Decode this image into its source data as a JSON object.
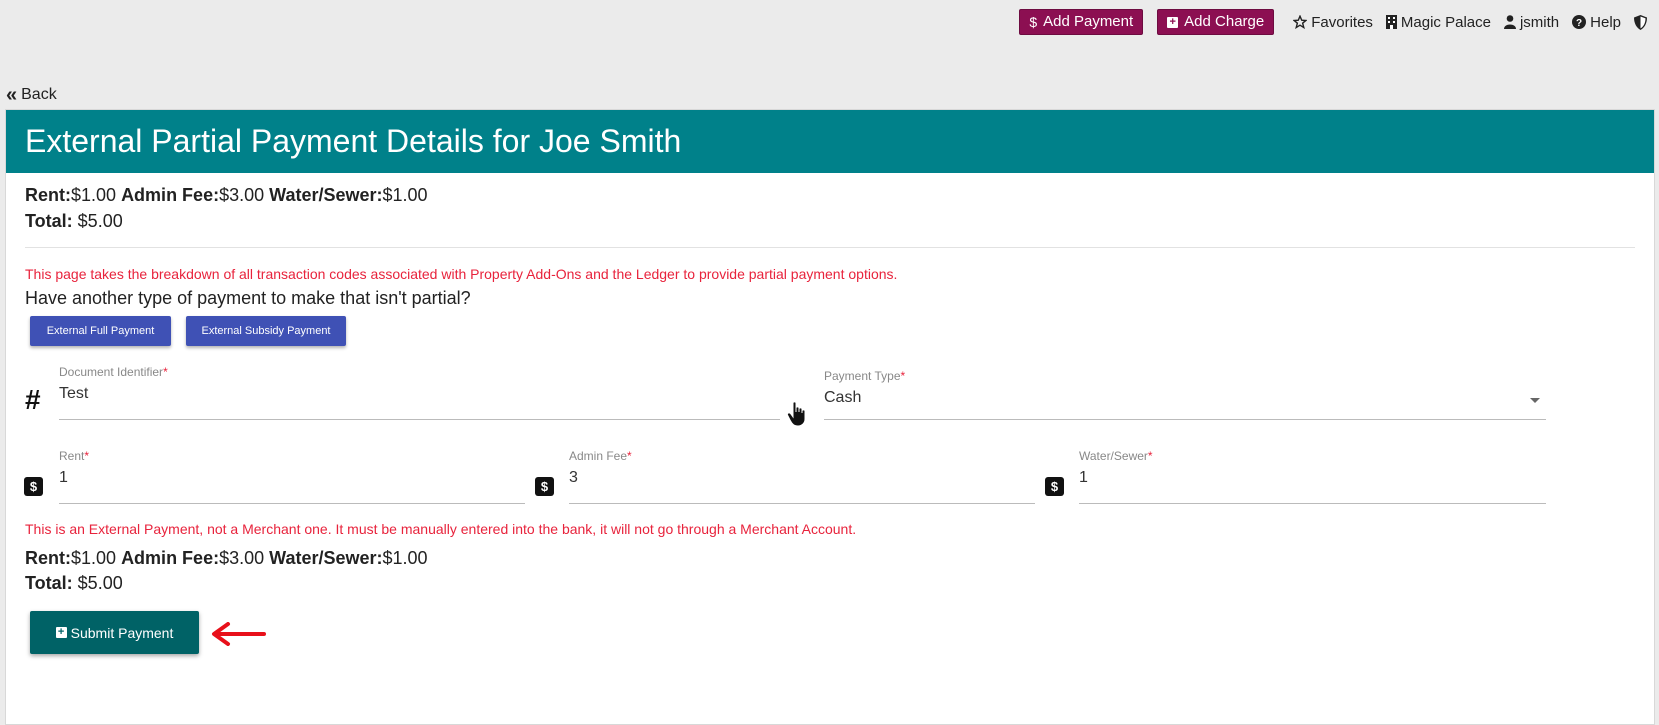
{
  "topbar": {
    "add_payment": "Add Payment",
    "add_charge": "Add Charge",
    "favorites": "Favorites",
    "property": "Magic Palace",
    "user": "jsmith",
    "help": "Help",
    "brand_color": "#8c0f52"
  },
  "back_label": "Back",
  "header": {
    "title": "External Partial Payment Details for Joe Smith",
    "color": "#00818a"
  },
  "summary_top": {
    "rent_label": "Rent:",
    "rent_value": "$1.00",
    "admin_label": "Admin Fee:",
    "admin_value": "$3.00",
    "water_label": "Water/Sewer:",
    "water_value": "$1.00",
    "total_label": "Total:",
    "total_value": "$5.00"
  },
  "info_note": "This page takes the breakdown of all transaction codes associated with Property Add-Ons and the Ledger to provide partial payment options.",
  "question": "Have another type of payment to make that isn't partial?",
  "alt_buttons": {
    "full": "External Full Payment",
    "subsidy": "External Subsidy Payment"
  },
  "form": {
    "doc_id": {
      "label": "Document Identifier",
      "value": "Test"
    },
    "payment_type": {
      "label": "Payment Type",
      "value": "Cash"
    },
    "rent": {
      "label": "Rent",
      "value": "1"
    },
    "admin_fee": {
      "label": "Admin Fee",
      "value": "3"
    },
    "water_sewer": {
      "label": "Water/Sewer",
      "value": "1"
    },
    "required_mark": "*"
  },
  "warning_note": "This is an External Payment, not a Merchant one. It must be manually entered into the bank, it will not go through a Merchant Account.",
  "summary_bottom": {
    "rent_label": "Rent:",
    "rent_value": "$1.00",
    "admin_label": "Admin Fee:",
    "admin_value": "$3.00",
    "water_label": "Water/Sewer:",
    "water_value": "$1.00",
    "total_label": "Total:",
    "total_value": "$5.00"
  },
  "submit_label": "Submit Payment",
  "icons": {
    "dollar": "$",
    "hash": "#",
    "back": "«"
  }
}
